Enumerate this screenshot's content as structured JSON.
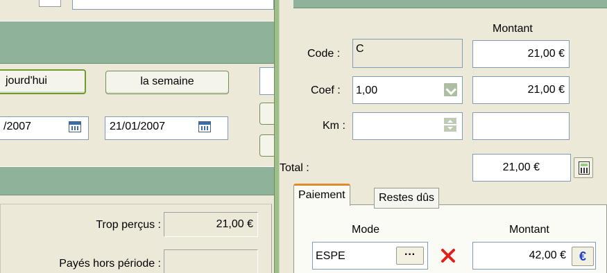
{
  "left": {
    "period_buttons": {
      "today_label": "jourd'hui",
      "week_label": "la semaine"
    },
    "dates": {
      "start": "/2007",
      "end": "21/01/2007"
    },
    "summary": {
      "trop_percus_label": "Trop perçus :",
      "trop_percus_value": "21,00 €",
      "payes_hors_periode_label": "Payés hors période :",
      "payes_hors_periode_value": ""
    }
  },
  "right": {
    "montant_header": "Montant",
    "code": {
      "label": "Code :",
      "value": "C",
      "montant": "21,00 €"
    },
    "coef": {
      "label": "Coef :",
      "value": "1,00",
      "montant": "21,00 €"
    },
    "km": {
      "label": "Km :",
      "value": "",
      "montant": ""
    },
    "total": {
      "label": "Total :",
      "value": "21,00 €"
    },
    "tabs": [
      {
        "label": "Paiement"
      },
      {
        "label": "Restes dûs"
      }
    ],
    "payment": {
      "mode_header": "Mode",
      "montant_header": "Montant",
      "mode_value": "ESPE",
      "more_label": "···",
      "amount": "42,00 €",
      "currency_symbol": "€"
    }
  },
  "colors": {
    "band_green": "#8fb29a",
    "splitter_green": "#9fbf8a",
    "delete_red": "#e0201a",
    "euro_blue": "#1a3fcf",
    "tab_accent": "#e08a2a"
  },
  "icons": [
    "calendar-icon",
    "calendar-icon",
    "dropdown-arrow-icon",
    "spinner-icon",
    "calculator-icon",
    "ellipsis-icon",
    "delete-x-icon",
    "euro-icon"
  ]
}
